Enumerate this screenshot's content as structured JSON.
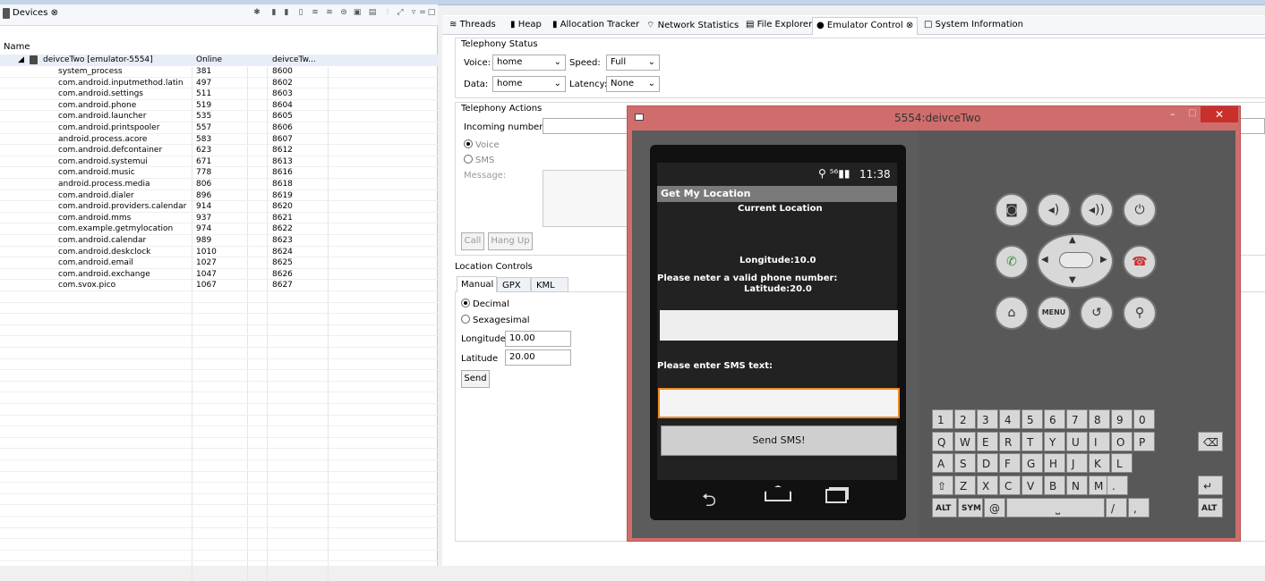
{
  "devices_view": {
    "title": "Devices ⊗",
    "column_name": "Name",
    "device": {
      "name": "deivceTwo [emulator-5554]",
      "state": "Online",
      "serial": "deivceTw..."
    },
    "processes": [
      {
        "name": "system_process",
        "pid": "381",
        "port": "8600"
      },
      {
        "name": "com.android.inputmethod.latin",
        "pid": "497",
        "port": "8602"
      },
      {
        "name": "com.android.settings",
        "pid": "511",
        "port": "8603"
      },
      {
        "name": "com.android.phone",
        "pid": "519",
        "port": "8604"
      },
      {
        "name": "com.android.launcher",
        "pid": "535",
        "port": "8605"
      },
      {
        "name": "com.android.printspooler",
        "pid": "557",
        "port": "8606"
      },
      {
        "name": "android.process.acore",
        "pid": "583",
        "port": "8607"
      },
      {
        "name": "com.android.defcontainer",
        "pid": "623",
        "port": "8612"
      },
      {
        "name": "com.android.systemui",
        "pid": "671",
        "port": "8613"
      },
      {
        "name": "com.android.music",
        "pid": "778",
        "port": "8616"
      },
      {
        "name": "android.process.media",
        "pid": "806",
        "port": "8618"
      },
      {
        "name": "com.android.dialer",
        "pid": "896",
        "port": "8619"
      },
      {
        "name": "com.android.providers.calendar",
        "pid": "914",
        "port": "8620"
      },
      {
        "name": "com.android.mms",
        "pid": "937",
        "port": "8621"
      },
      {
        "name": "com.example.getmylocation",
        "pid": "974",
        "port": "8622"
      },
      {
        "name": "com.android.calendar",
        "pid": "989",
        "port": "8623"
      },
      {
        "name": "com.android.deskclock",
        "pid": "1010",
        "port": "8624"
      },
      {
        "name": "com.android.email",
        "pid": "1027",
        "port": "8625"
      },
      {
        "name": "com.android.exchange",
        "pid": "1047",
        "port": "8626"
      },
      {
        "name": "com.svox.pico",
        "pid": "1067",
        "port": "8627"
      }
    ]
  },
  "tabs": [
    "Threads",
    "Heap",
    "Allocation Tracker",
    "Network Statistics",
    "File Explorer",
    "Emulator Control ⊗",
    "System Information"
  ],
  "telephony_status": {
    "title": "Telephony Status",
    "voice_label": "Voice:",
    "voice_value": "home",
    "speed_label": "Speed:",
    "speed_value": "Full",
    "data_label": "Data:",
    "data_value": "home",
    "latency_label": "Latency:",
    "latency_value": "None"
  },
  "telephony_actions": {
    "title": "Telephony Actions",
    "incoming_label": "Incoming number:",
    "voice": "Voice",
    "sms": "SMS",
    "message_label": "Message:",
    "call": "Call",
    "hangup": "Hang Up"
  },
  "location": {
    "title": "Location Controls",
    "tabs": [
      "Manual",
      "GPX",
      "KML"
    ],
    "decimal": "Decimal",
    "sexagesimal": "Sexagesimal",
    "longitude_label": "Longitude",
    "longitude_value": "10.00",
    "latitude_label": "Latitude",
    "latitude_value": "20.00",
    "send": "Send"
  },
  "emulator": {
    "title": "5554:deivceTwo",
    "time": "11:38",
    "app_title": "Get My Location",
    "current_location": "Current Location",
    "longitude_text": "Longitude:10.0",
    "phone_prompt": "Please neter a valid phone number:",
    "latitude_text": "Latitude:20.0",
    "sms_prompt": "Please enter SMS text:",
    "send_sms": "Send SMS!",
    "menu_key": "MENU",
    "kbd_row1": [
      "1",
      "2",
      "3",
      "4",
      "5",
      "6",
      "7",
      "8",
      "9",
      "0"
    ],
    "kbd_row2": [
      "Q",
      "W",
      "E",
      "R",
      "T",
      "Y",
      "U",
      "I",
      "O",
      "P"
    ],
    "kbd_row3": [
      "A",
      "S",
      "D",
      "F",
      "G",
      "H",
      "J",
      "K",
      "L"
    ],
    "kbd_row4": [
      "Z",
      "X",
      "C",
      "V",
      "B",
      "N",
      "M"
    ],
    "alt": "ALT",
    "sym": "SYM",
    "at": "@"
  }
}
